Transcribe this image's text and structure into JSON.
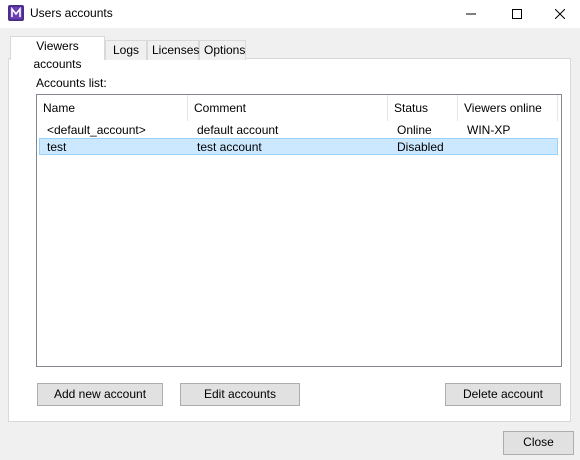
{
  "window": {
    "title": "Users accounts"
  },
  "tabs": [
    {
      "label": "Viewers accounts",
      "active": true
    },
    {
      "label": "Logs",
      "active": false
    },
    {
      "label": "Licenses",
      "active": false
    },
    {
      "label": "Options",
      "active": false
    }
  ],
  "accounts": {
    "label": "Accounts list:",
    "columns": [
      "Name",
      "Comment",
      "Status",
      "Viewers online"
    ],
    "rows": [
      {
        "name": "<default_account>",
        "comment": "default account",
        "status": "Online",
        "viewers": "WIN-XP",
        "selected": false
      },
      {
        "name": "test",
        "comment": "test account",
        "status": "Disabled",
        "viewers": "",
        "selected": true
      }
    ]
  },
  "buttons": {
    "add": "Add new account",
    "edit": "Edit accounts",
    "delete": "Delete account",
    "close": "Close"
  },
  "colors": {
    "selection": "#cce8ff",
    "selection_border": "#99d1ff",
    "app_icon": "#4b2d8a"
  },
  "icons": {
    "app": "app-logo-icon",
    "minimize": "minimize-icon",
    "maximize": "maximize-icon",
    "close": "close-icon"
  }
}
